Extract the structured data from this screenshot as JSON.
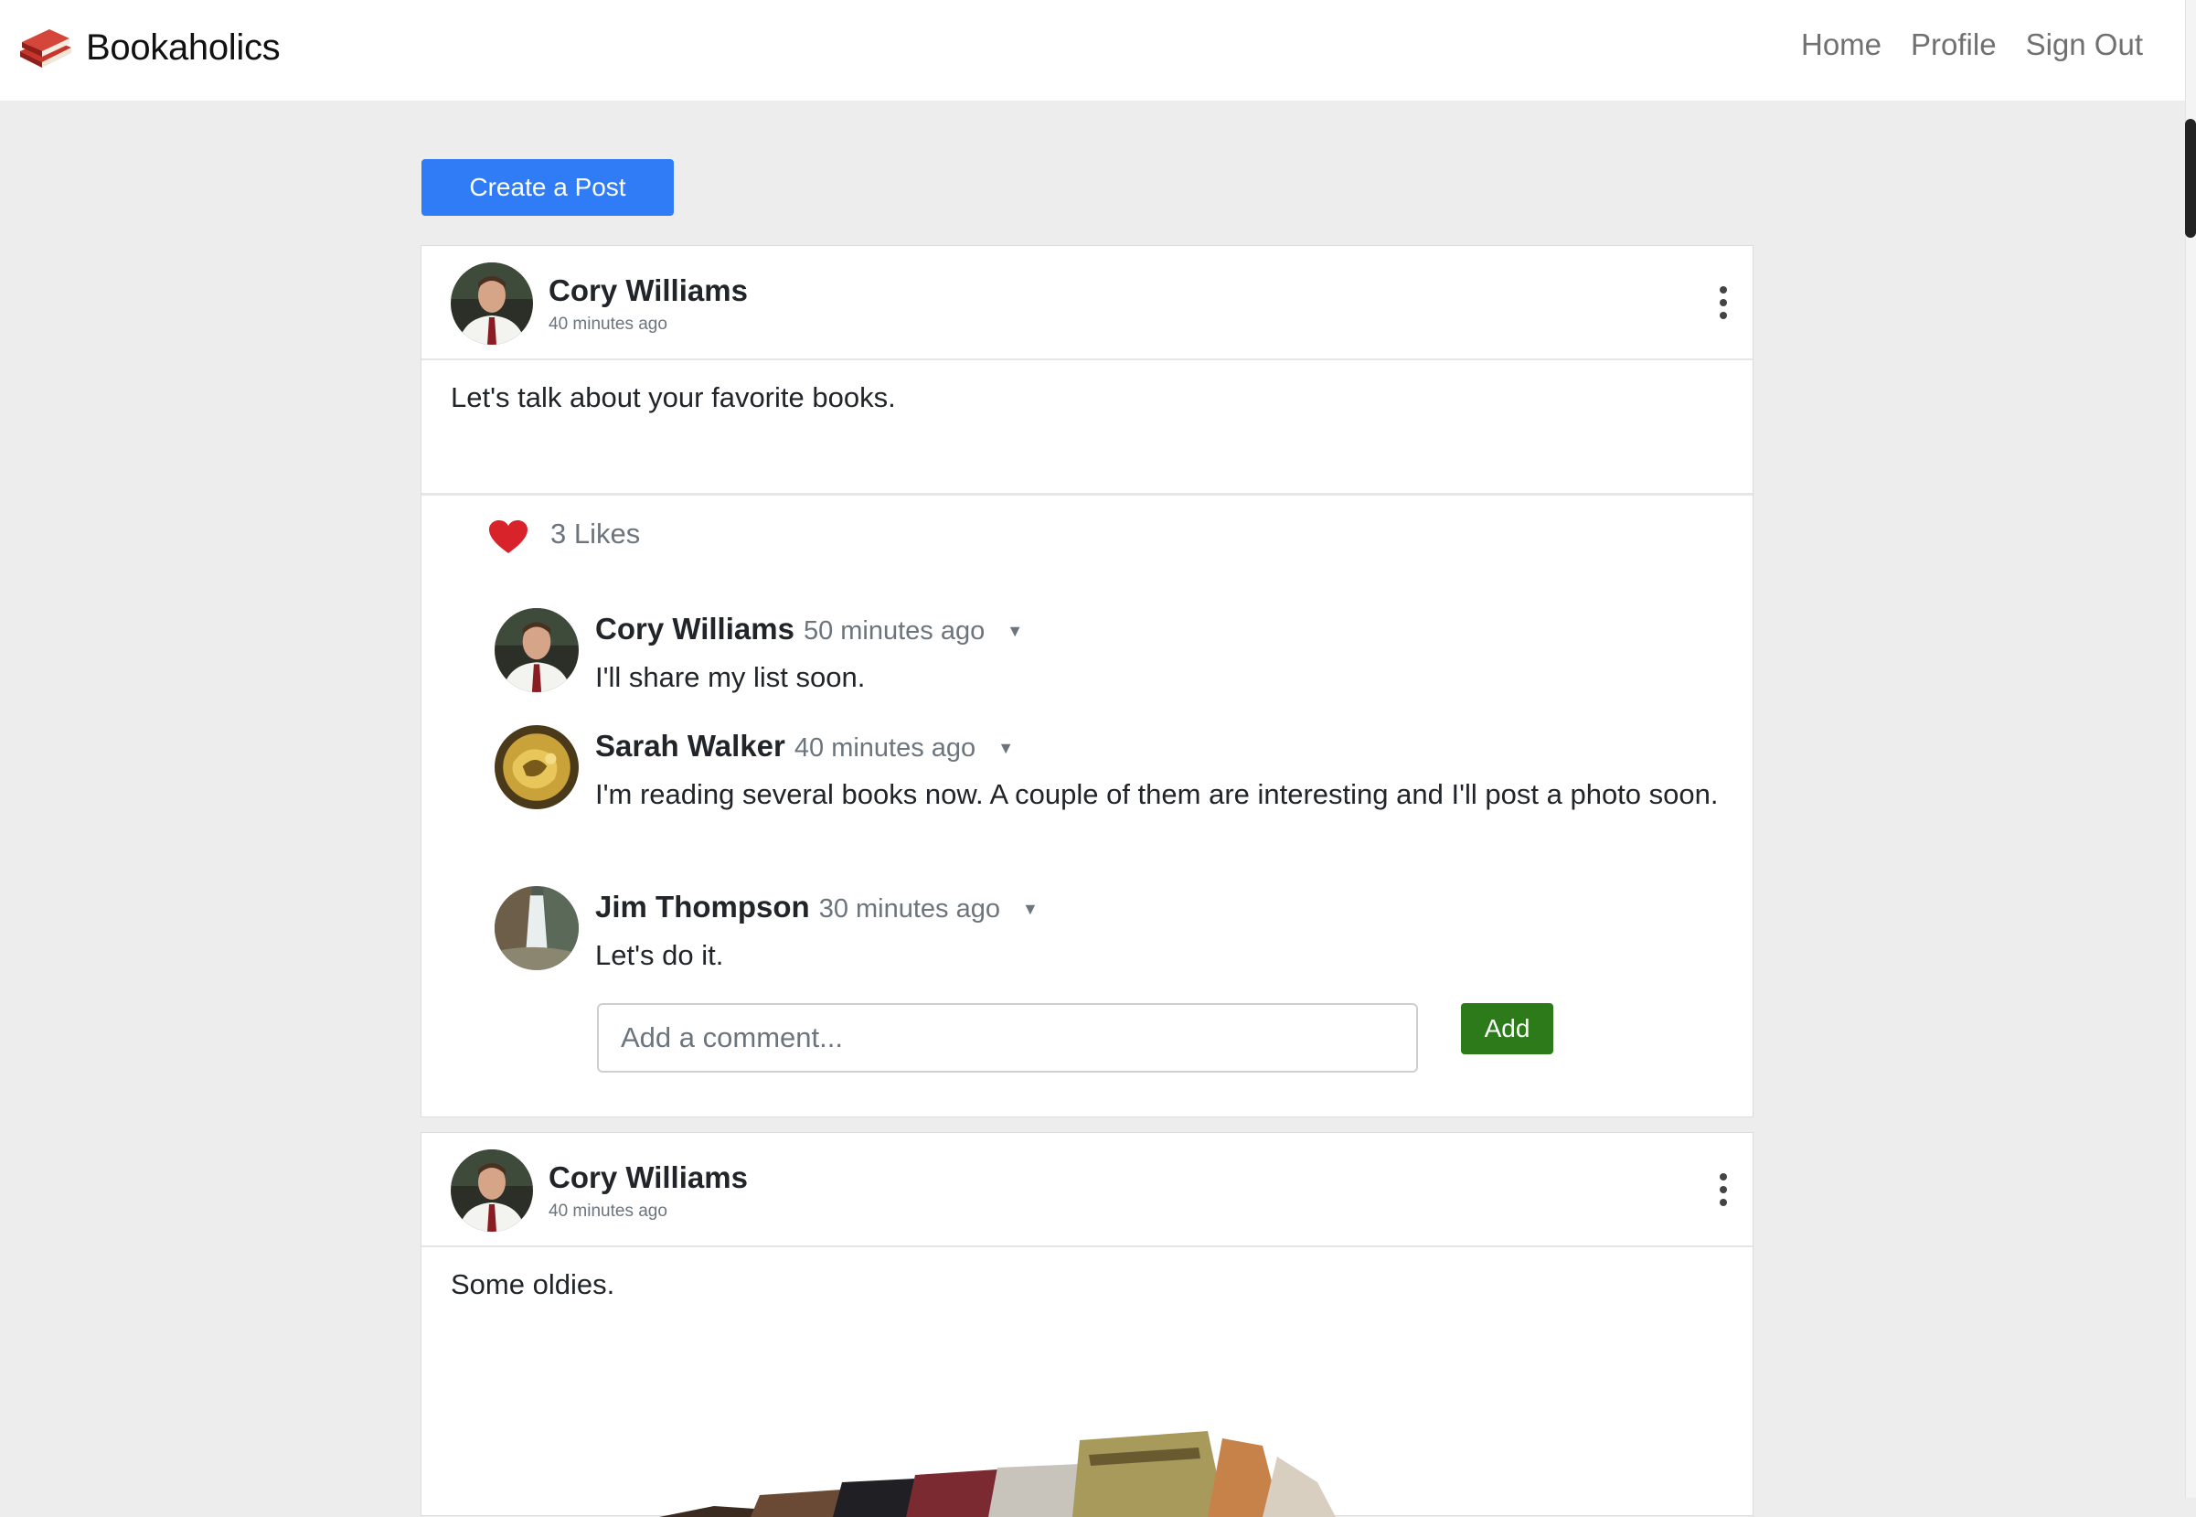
{
  "nav": {
    "brand": "Bookaholics",
    "links": {
      "home": "Home",
      "profile": "Profile",
      "sign_out": "Sign Out"
    }
  },
  "create_post_label": "Create a Post",
  "posts": [
    {
      "author": "Cory Williams",
      "time": "40 minutes ago",
      "body": "Let's talk about your favorite books.",
      "likes": "3 Likes",
      "comments": [
        {
          "author": "Cory Williams",
          "time": "50 minutes ago",
          "text": "I'll share my list soon."
        },
        {
          "author": "Sarah Walker",
          "time": "40 minutes ago",
          "text": "I'm reading several books now. A couple of them are interesting and I'll post a photo soon."
        },
        {
          "author": "Jim Thompson",
          "time": "30 minutes ago",
          "text": "Let's do it."
        }
      ],
      "comment_placeholder": "Add a comment...",
      "add_label": "Add"
    },
    {
      "author": "Cory Williams",
      "time": "40 minutes ago",
      "body": "Some oldies."
    }
  ],
  "icons": {
    "brand": "book-stack-icon",
    "like": "heart-icon",
    "menu": "vertical-dots-icon",
    "comment_menu": "caret-down-icon"
  },
  "colors": {
    "primary": "#2f7cf6",
    "add": "#2d7a1b",
    "heart": "#d8232a",
    "logo": "#b32a22"
  },
  "caret": "▼"
}
